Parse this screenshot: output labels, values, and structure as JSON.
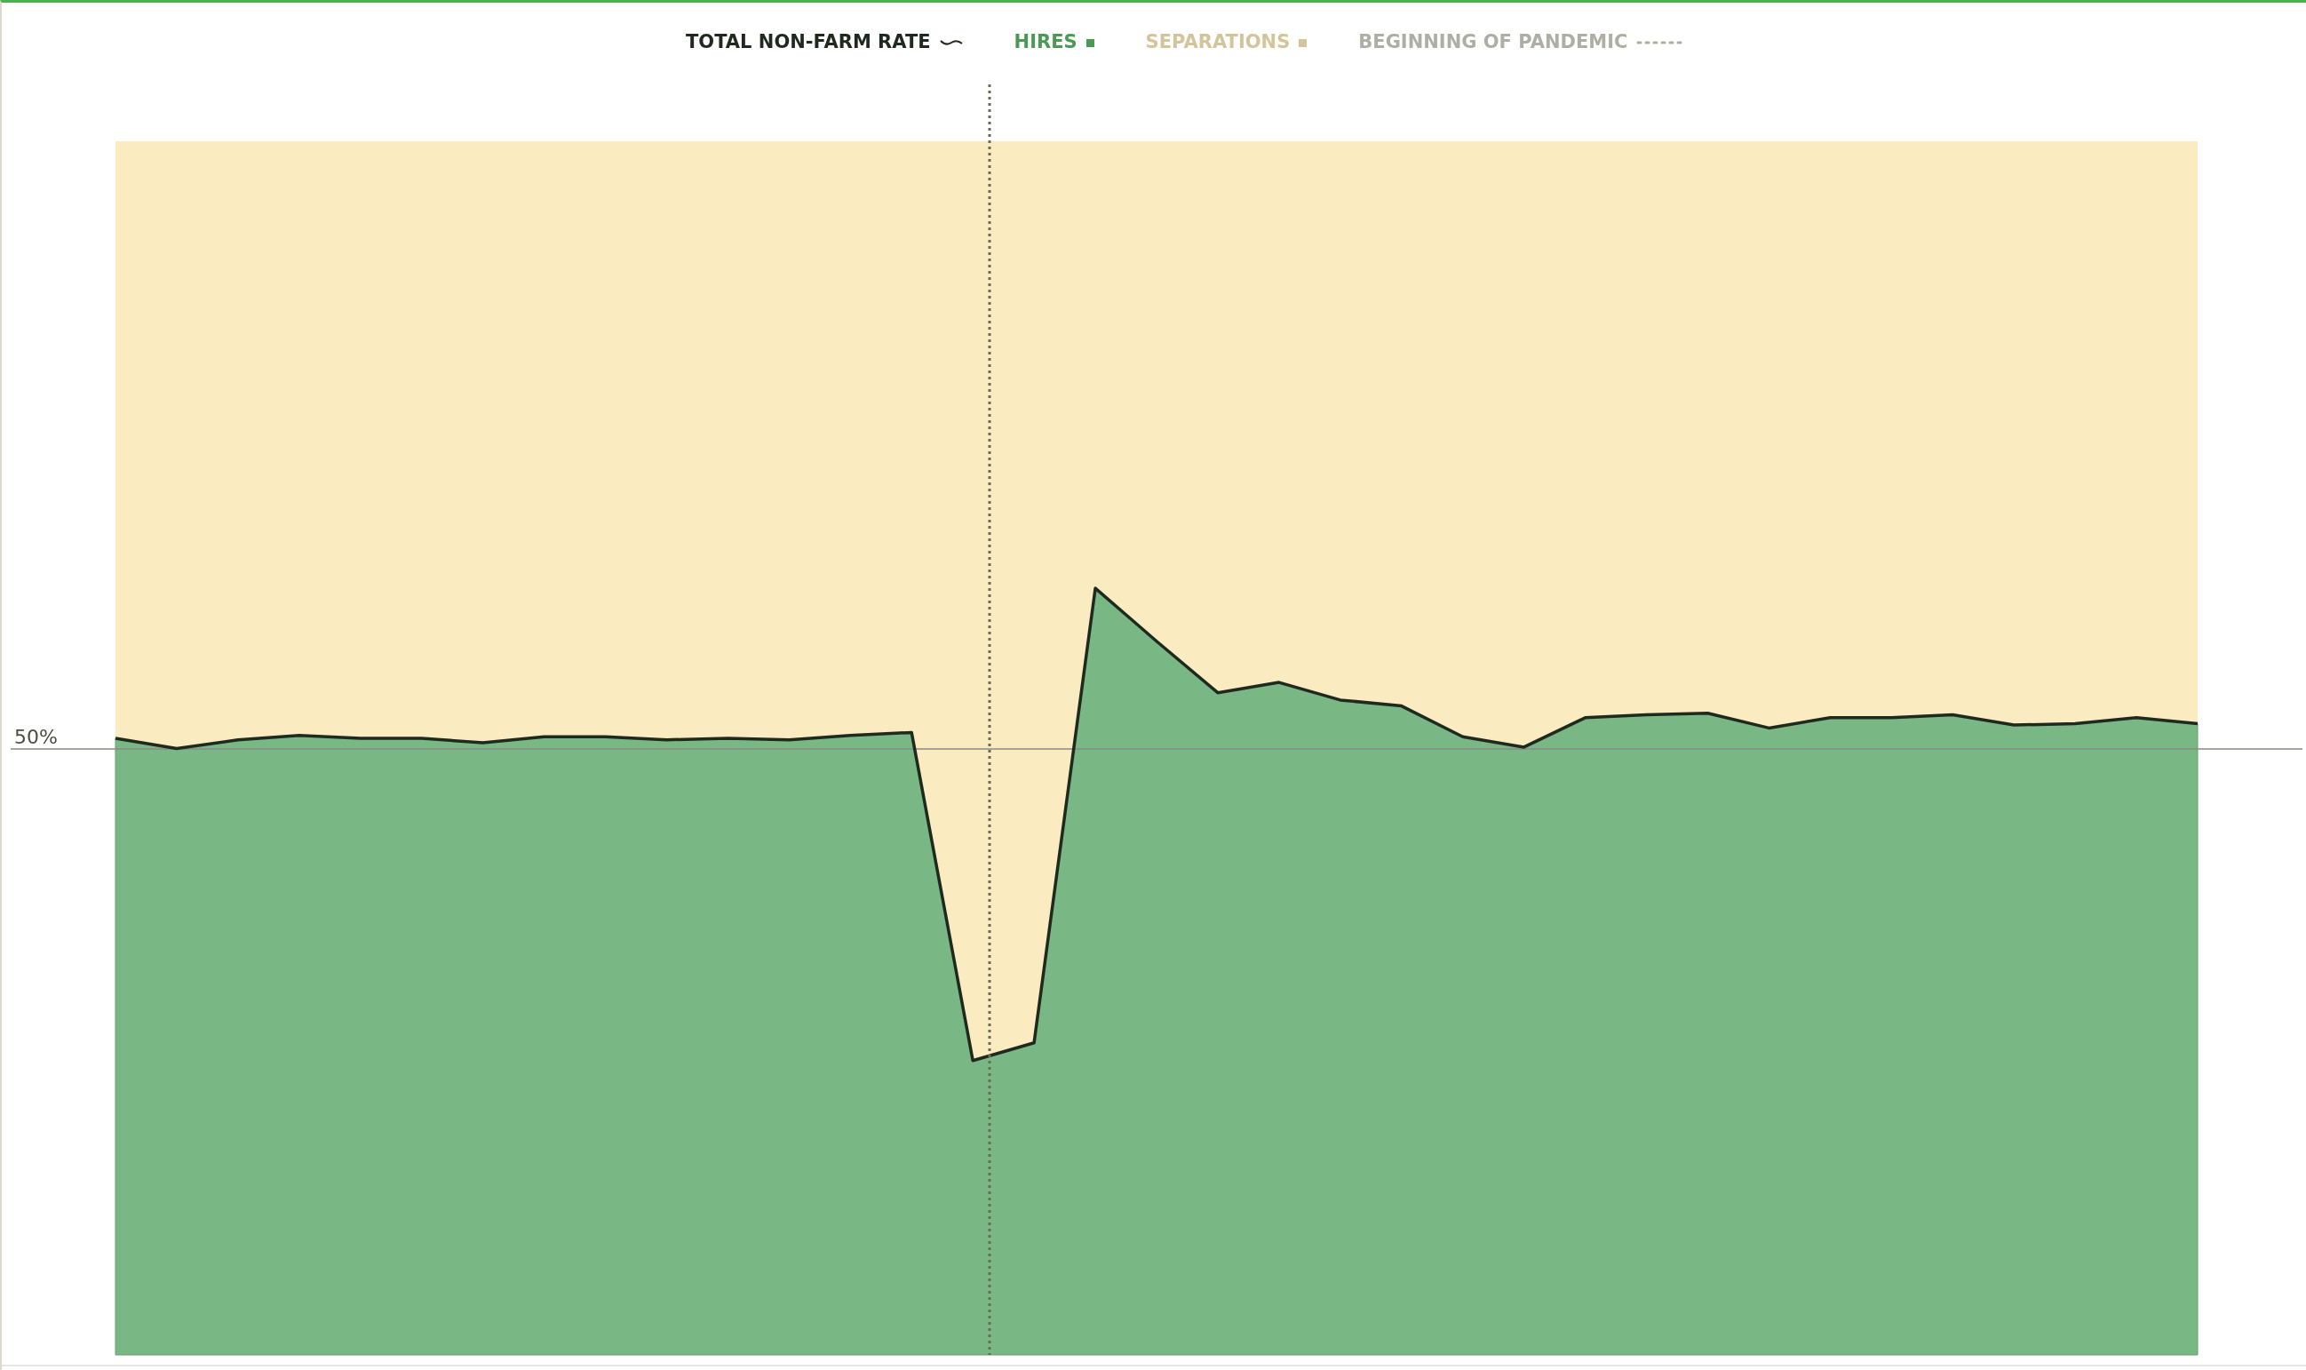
{
  "legend": [
    {
      "label": "TOTAL NON-FARM RATE",
      "kind": "line",
      "color": "#1f2a1f"
    },
    {
      "label": "HIRES",
      "kind": "square",
      "color": "#4a9a55"
    },
    {
      "label": "SEPARATIONS",
      "kind": "square",
      "color": "#d4c49a"
    },
    {
      "label": "BEGINNING OF PANDEMIC",
      "kind": "dotted",
      "color": "#b0aea4"
    }
  ],
  "chart": {
    "axis_label": "50%"
  }
}
